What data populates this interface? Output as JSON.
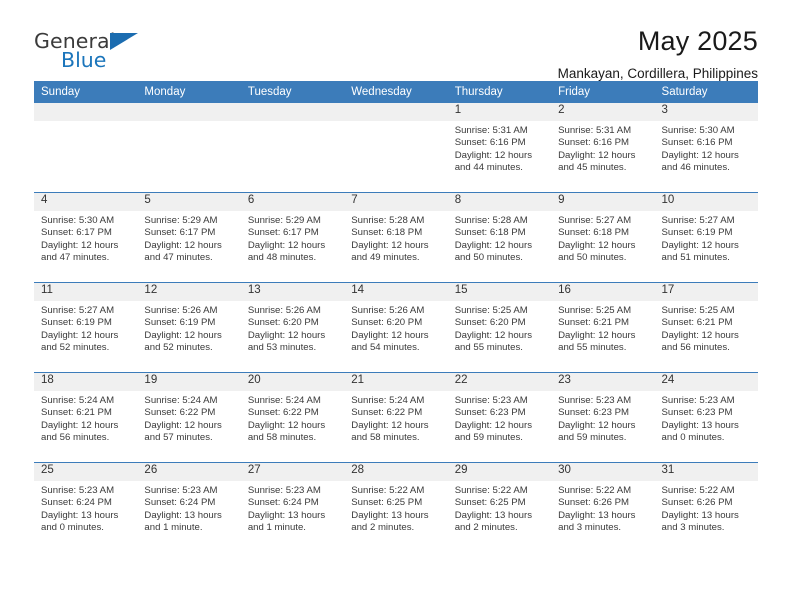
{
  "brand": {
    "name_part1": "General",
    "name_part2": "Blue",
    "flag_icon": "triangle-flag-icon"
  },
  "header": {
    "title": "May 2025",
    "subtitle": "Mankayan, Cordillera, Philippines"
  },
  "theme": {
    "header_blue": "#3c7cba",
    "band_gray": "#f0f0f0",
    "brand_blue": "#1b75bb",
    "text": "#333333"
  },
  "calendar": {
    "weekday_headers": [
      "Sunday",
      "Monday",
      "Tuesday",
      "Wednesday",
      "Thursday",
      "Friday",
      "Saturday"
    ],
    "weeks": [
      [
        {
          "day": "",
          "sunrise": "",
          "sunset": "",
          "daylight1": "",
          "daylight2": "",
          "empty": true
        },
        {
          "day": "",
          "sunrise": "",
          "sunset": "",
          "daylight1": "",
          "daylight2": "",
          "empty": true
        },
        {
          "day": "",
          "sunrise": "",
          "sunset": "",
          "daylight1": "",
          "daylight2": "",
          "empty": true
        },
        {
          "day": "",
          "sunrise": "",
          "sunset": "",
          "daylight1": "",
          "daylight2": "",
          "empty": true
        },
        {
          "day": "1",
          "sunrise": "Sunrise: 5:31 AM",
          "sunset": "Sunset: 6:16 PM",
          "daylight1": "Daylight: 12 hours",
          "daylight2": "and 44 minutes."
        },
        {
          "day": "2",
          "sunrise": "Sunrise: 5:31 AM",
          "sunset": "Sunset: 6:16 PM",
          "daylight1": "Daylight: 12 hours",
          "daylight2": "and 45 minutes."
        },
        {
          "day": "3",
          "sunrise": "Sunrise: 5:30 AM",
          "sunset": "Sunset: 6:16 PM",
          "daylight1": "Daylight: 12 hours",
          "daylight2": "and 46 minutes."
        }
      ],
      [
        {
          "day": "4",
          "sunrise": "Sunrise: 5:30 AM",
          "sunset": "Sunset: 6:17 PM",
          "daylight1": "Daylight: 12 hours",
          "daylight2": "and 47 minutes."
        },
        {
          "day": "5",
          "sunrise": "Sunrise: 5:29 AM",
          "sunset": "Sunset: 6:17 PM",
          "daylight1": "Daylight: 12 hours",
          "daylight2": "and 47 minutes."
        },
        {
          "day": "6",
          "sunrise": "Sunrise: 5:29 AM",
          "sunset": "Sunset: 6:17 PM",
          "daylight1": "Daylight: 12 hours",
          "daylight2": "and 48 minutes."
        },
        {
          "day": "7",
          "sunrise": "Sunrise: 5:28 AM",
          "sunset": "Sunset: 6:18 PM",
          "daylight1": "Daylight: 12 hours",
          "daylight2": "and 49 minutes."
        },
        {
          "day": "8",
          "sunrise": "Sunrise: 5:28 AM",
          "sunset": "Sunset: 6:18 PM",
          "daylight1": "Daylight: 12 hours",
          "daylight2": "and 50 minutes."
        },
        {
          "day": "9",
          "sunrise": "Sunrise: 5:27 AM",
          "sunset": "Sunset: 6:18 PM",
          "daylight1": "Daylight: 12 hours",
          "daylight2": "and 50 minutes."
        },
        {
          "day": "10",
          "sunrise": "Sunrise: 5:27 AM",
          "sunset": "Sunset: 6:19 PM",
          "daylight1": "Daylight: 12 hours",
          "daylight2": "and 51 minutes."
        }
      ],
      [
        {
          "day": "11",
          "sunrise": "Sunrise: 5:27 AM",
          "sunset": "Sunset: 6:19 PM",
          "daylight1": "Daylight: 12 hours",
          "daylight2": "and 52 minutes."
        },
        {
          "day": "12",
          "sunrise": "Sunrise: 5:26 AM",
          "sunset": "Sunset: 6:19 PM",
          "daylight1": "Daylight: 12 hours",
          "daylight2": "and 52 minutes."
        },
        {
          "day": "13",
          "sunrise": "Sunrise: 5:26 AM",
          "sunset": "Sunset: 6:20 PM",
          "daylight1": "Daylight: 12 hours",
          "daylight2": "and 53 minutes."
        },
        {
          "day": "14",
          "sunrise": "Sunrise: 5:26 AM",
          "sunset": "Sunset: 6:20 PM",
          "daylight1": "Daylight: 12 hours",
          "daylight2": "and 54 minutes."
        },
        {
          "day": "15",
          "sunrise": "Sunrise: 5:25 AM",
          "sunset": "Sunset: 6:20 PM",
          "daylight1": "Daylight: 12 hours",
          "daylight2": "and 55 minutes."
        },
        {
          "day": "16",
          "sunrise": "Sunrise: 5:25 AM",
          "sunset": "Sunset: 6:21 PM",
          "daylight1": "Daylight: 12 hours",
          "daylight2": "and 55 minutes."
        },
        {
          "day": "17",
          "sunrise": "Sunrise: 5:25 AM",
          "sunset": "Sunset: 6:21 PM",
          "daylight1": "Daylight: 12 hours",
          "daylight2": "and 56 minutes."
        }
      ],
      [
        {
          "day": "18",
          "sunrise": "Sunrise: 5:24 AM",
          "sunset": "Sunset: 6:21 PM",
          "daylight1": "Daylight: 12 hours",
          "daylight2": "and 56 minutes."
        },
        {
          "day": "19",
          "sunrise": "Sunrise: 5:24 AM",
          "sunset": "Sunset: 6:22 PM",
          "daylight1": "Daylight: 12 hours",
          "daylight2": "and 57 minutes."
        },
        {
          "day": "20",
          "sunrise": "Sunrise: 5:24 AM",
          "sunset": "Sunset: 6:22 PM",
          "daylight1": "Daylight: 12 hours",
          "daylight2": "and 58 minutes."
        },
        {
          "day": "21",
          "sunrise": "Sunrise: 5:24 AM",
          "sunset": "Sunset: 6:22 PM",
          "daylight1": "Daylight: 12 hours",
          "daylight2": "and 58 minutes."
        },
        {
          "day": "22",
          "sunrise": "Sunrise: 5:23 AM",
          "sunset": "Sunset: 6:23 PM",
          "daylight1": "Daylight: 12 hours",
          "daylight2": "and 59 minutes."
        },
        {
          "day": "23",
          "sunrise": "Sunrise: 5:23 AM",
          "sunset": "Sunset: 6:23 PM",
          "daylight1": "Daylight: 12 hours",
          "daylight2": "and 59 minutes."
        },
        {
          "day": "24",
          "sunrise": "Sunrise: 5:23 AM",
          "sunset": "Sunset: 6:23 PM",
          "daylight1": "Daylight: 13 hours",
          "daylight2": "and 0 minutes."
        }
      ],
      [
        {
          "day": "25",
          "sunrise": "Sunrise: 5:23 AM",
          "sunset": "Sunset: 6:24 PM",
          "daylight1": "Daylight: 13 hours",
          "daylight2": "and 0 minutes."
        },
        {
          "day": "26",
          "sunrise": "Sunrise: 5:23 AM",
          "sunset": "Sunset: 6:24 PM",
          "daylight1": "Daylight: 13 hours",
          "daylight2": "and 1 minute."
        },
        {
          "day": "27",
          "sunrise": "Sunrise: 5:23 AM",
          "sunset": "Sunset: 6:24 PM",
          "daylight1": "Daylight: 13 hours",
          "daylight2": "and 1 minute."
        },
        {
          "day": "28",
          "sunrise": "Sunrise: 5:22 AM",
          "sunset": "Sunset: 6:25 PM",
          "daylight1": "Daylight: 13 hours",
          "daylight2": "and 2 minutes."
        },
        {
          "day": "29",
          "sunrise": "Sunrise: 5:22 AM",
          "sunset": "Sunset: 6:25 PM",
          "daylight1": "Daylight: 13 hours",
          "daylight2": "and 2 minutes."
        },
        {
          "day": "30",
          "sunrise": "Sunrise: 5:22 AM",
          "sunset": "Sunset: 6:26 PM",
          "daylight1": "Daylight: 13 hours",
          "daylight2": "and 3 minutes."
        },
        {
          "day": "31",
          "sunrise": "Sunrise: 5:22 AM",
          "sunset": "Sunset: 6:26 PM",
          "daylight1": "Daylight: 13 hours",
          "daylight2": "and 3 minutes."
        }
      ]
    ]
  }
}
